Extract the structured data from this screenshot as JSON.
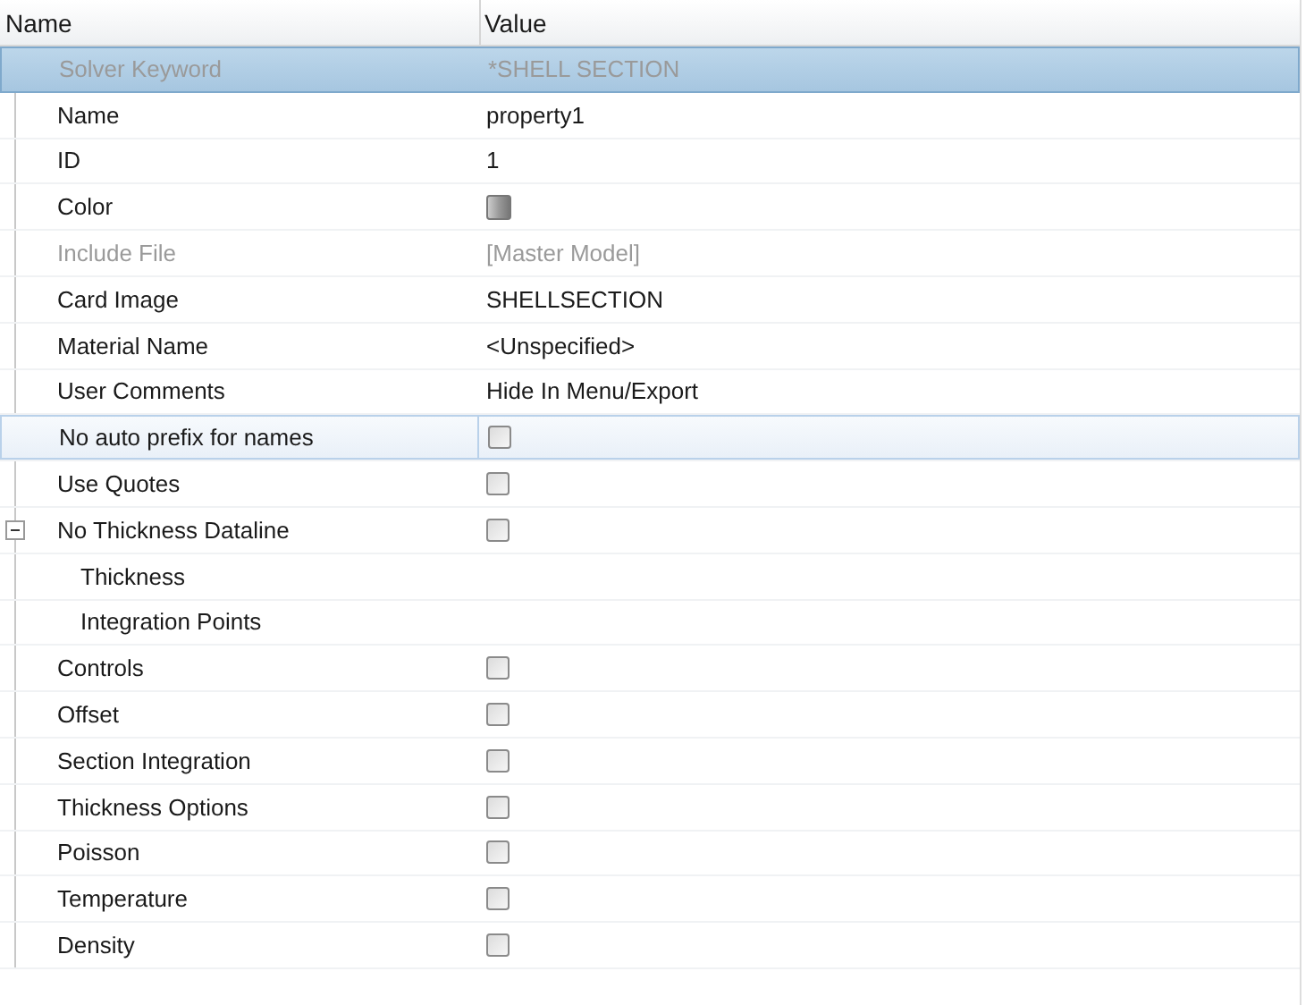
{
  "columns": [
    "Name",
    "Value"
  ],
  "rows": [
    {
      "name": "Solver Keyword",
      "kind": "text",
      "value": "*SHELL SECTION",
      "disabled": true,
      "selected": true,
      "hover": false
    },
    {
      "name": "Name",
      "kind": "text",
      "value": "property1",
      "disabled": false,
      "selected": false,
      "hover": false
    },
    {
      "name": "ID",
      "kind": "text",
      "value": "1",
      "disabled": false,
      "selected": false,
      "hover": false
    },
    {
      "name": "Color",
      "kind": "color",
      "color": "#9a9a9a",
      "disabled": false,
      "selected": false,
      "hover": false
    },
    {
      "name": "Include File",
      "kind": "text",
      "value": "[Master Model]",
      "disabled": true,
      "selected": false,
      "hover": false
    },
    {
      "name": "Card Image",
      "kind": "text",
      "value": "SHELLSECTION",
      "disabled": false,
      "selected": false,
      "hover": false
    },
    {
      "name": "Material Name",
      "kind": "text",
      "value": "<Unspecified>",
      "disabled": false,
      "selected": false,
      "hover": false
    },
    {
      "name": "User Comments",
      "kind": "text",
      "value": "Hide In Menu/Export",
      "disabled": false,
      "selected": false,
      "hover": false
    },
    {
      "name": "No auto prefix for names",
      "kind": "checkbox",
      "checked": false,
      "disabled": false,
      "selected": false,
      "hover": true
    },
    {
      "name": "Use Quotes",
      "kind": "checkbox",
      "checked": false,
      "disabled": false,
      "selected": false,
      "hover": false
    },
    {
      "name": "No Thickness Dataline",
      "kind": "checkbox",
      "checked": false,
      "disabled": false,
      "selected": false,
      "hover": false,
      "expanded": true,
      "children": [
        {
          "name": "Thickness",
          "disabled": false,
          "selected": false,
          "hover": false
        },
        {
          "name": "Integration Points",
          "disabled": false,
          "selected": false,
          "hover": false
        }
      ]
    },
    {
      "name": "Controls",
      "kind": "checkbox",
      "checked": false,
      "disabled": false,
      "selected": false,
      "hover": false
    },
    {
      "name": "Offset",
      "kind": "checkbox",
      "checked": false,
      "disabled": false,
      "selected": false,
      "hover": false
    },
    {
      "name": "Section Integration",
      "kind": "checkbox",
      "checked": false,
      "disabled": false,
      "selected": false,
      "hover": false
    },
    {
      "name": "Thickness Options",
      "kind": "checkbox",
      "checked": false,
      "disabled": false,
      "selected": false,
      "hover": false
    },
    {
      "name": "Poisson",
      "kind": "checkbox",
      "checked": false,
      "disabled": false,
      "selected": false,
      "hover": false
    },
    {
      "name": "Temperature",
      "kind": "checkbox",
      "checked": false,
      "disabled": false,
      "selected": false,
      "hover": false
    },
    {
      "name": "Density",
      "kind": "checkbox",
      "checked": false,
      "disabled": false,
      "selected": false,
      "hover": false
    }
  ]
}
